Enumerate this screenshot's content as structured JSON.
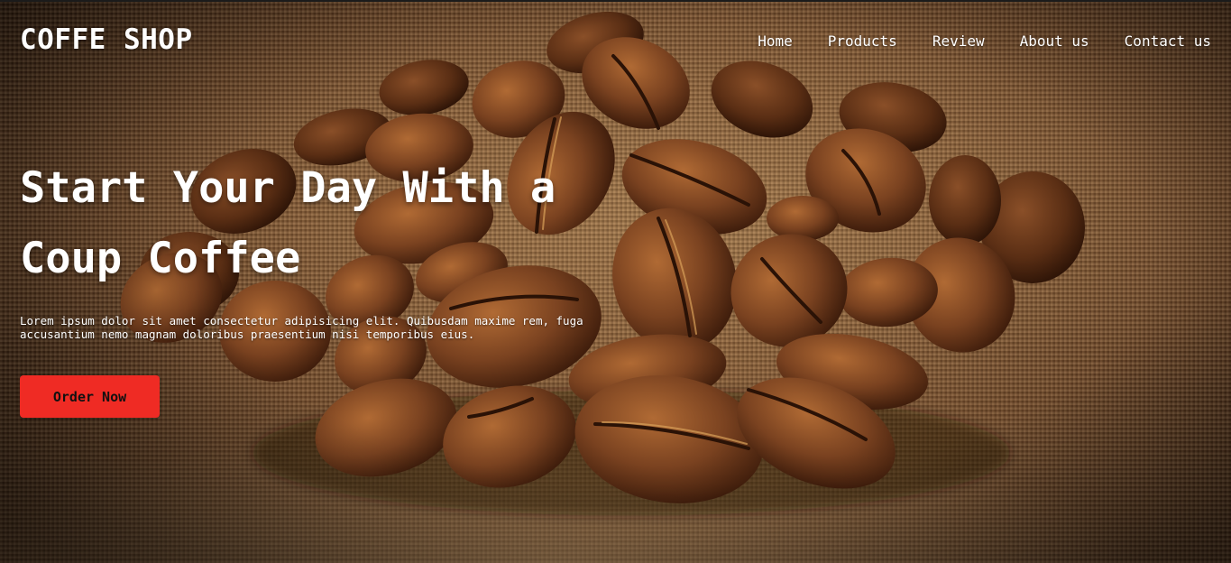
{
  "header": {
    "logo": "COFFE SHOP",
    "nav": [
      {
        "label": "Home"
      },
      {
        "label": "Products"
      },
      {
        "label": "Review"
      },
      {
        "label": "About us"
      },
      {
        "label": "Contact us"
      }
    ]
  },
  "hero": {
    "headline": "Start Your Day With a Coup Coffee",
    "description": "Lorem ipsum dolor sit amet consectetur adipisicing elit. Quibusdam maxime rem, fuga accusantium nemo magnam doloribus praesentium nisi temporibus eius.",
    "cta_label": "Order Now",
    "background_image": "coffee-beans-on-burlap"
  },
  "colors": {
    "accent": "#ef2b24",
    "text": "#ffffff",
    "bean_dark": "#4a2410",
    "bean_mid": "#7a4220",
    "bean_light": "#a8622e"
  }
}
